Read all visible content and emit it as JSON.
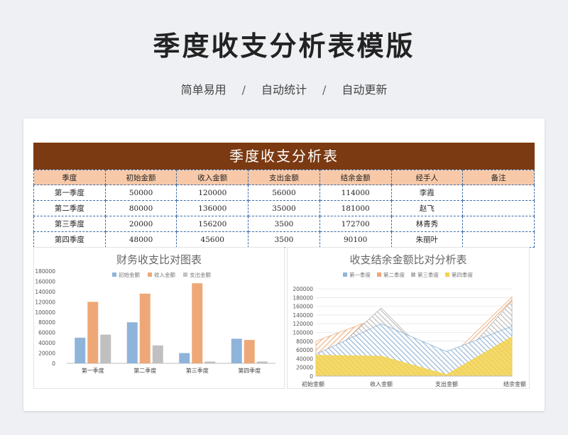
{
  "page": {
    "title": "季度收支分析表模版",
    "tags": [
      "简单易用",
      "自动统计",
      "自动更新"
    ],
    "separator": "/"
  },
  "table": {
    "title": "季度收支分析表",
    "headers": [
      "季度",
      "初始金额",
      "收入金额",
      "支出金额",
      "结余金额",
      "经手人",
      "备注"
    ],
    "rows": [
      [
        "第一季度",
        "50000",
        "120000",
        "56000",
        "114000",
        "李霞",
        ""
      ],
      [
        "第二季度",
        "80000",
        "136000",
        "35000",
        "181000",
        "赵飞",
        ""
      ],
      [
        "第三季度",
        "20000",
        "156200",
        "3500",
        "172700",
        "林青秀",
        ""
      ],
      [
        "第四季度",
        "48000",
        "45600",
        "3500",
        "90100",
        "朱丽叶",
        ""
      ]
    ],
    "colors": {
      "title_bg": "#7b3a12",
      "header_bg": "#f8c9a8",
      "border": "#3b6aa6"
    }
  },
  "chart_data": [
    {
      "type": "bar",
      "title": "财务收支比对图表",
      "categories": [
        "第一季度",
        "第二季度",
        "第三季度",
        "第四季度"
      ],
      "series": [
        {
          "name": "初始金额",
          "values": [
            50000,
            80000,
            20000,
            48000
          ],
          "color": "#8fb4da"
        },
        {
          "name": "收入金额",
          "values": [
            120000,
            136000,
            156200,
            45600
          ],
          "color": "#eea877"
        },
        {
          "name": "支出金额",
          "values": [
            56000,
            35000,
            3500,
            3500
          ],
          "color": "#c0c0c0"
        }
      ],
      "ylim": [
        0,
        180000
      ],
      "yticks": [
        "0",
        "20000",
        "40000",
        "60000",
        "80000",
        "100000",
        "120000",
        "140000",
        "160000",
        "180000"
      ],
      "legend": "top"
    },
    {
      "type": "area",
      "title": "收支结余金额比对分析表",
      "categories": [
        "初始金额",
        "收入金额",
        "支出金额",
        "结余金额"
      ],
      "series": [
        {
          "name": "第一季度",
          "values": [
            50000,
            120000,
            56000,
            114000
          ],
          "color": "#8fb4da"
        },
        {
          "name": "第二季度",
          "values": [
            80000,
            136000,
            35000,
            181000
          ],
          "color": "#eea877"
        },
        {
          "name": "第三季度",
          "values": [
            20000,
            156200,
            3500,
            172700
          ],
          "color": "#b5b5b5"
        },
        {
          "name": "第四季度",
          "values": [
            48000,
            45600,
            3500,
            90100
          ],
          "color": "#f5d24b"
        }
      ],
      "ylim": [
        0,
        200000
      ],
      "yticks": [
        "0",
        "20000",
        "40000",
        "60000",
        "80000",
        "100000",
        "120000",
        "140000",
        "160000",
        "180000",
        "200000"
      ],
      "legend": "top"
    }
  ]
}
